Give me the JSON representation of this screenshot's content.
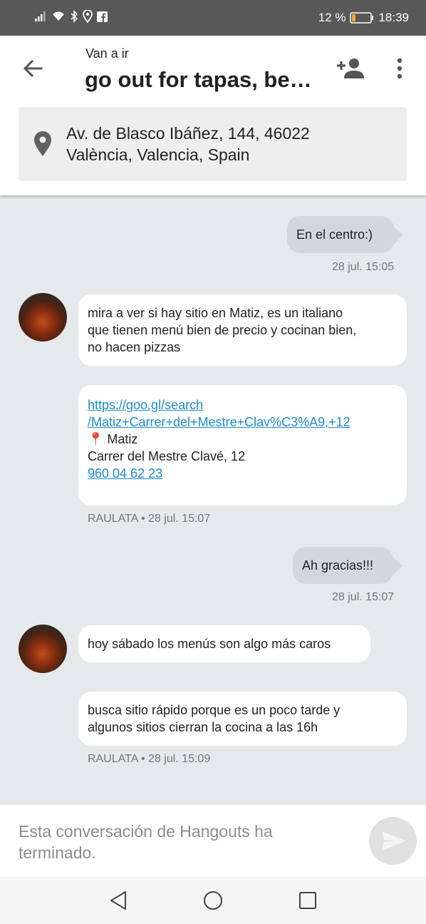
{
  "status_bar": {
    "battery": "12 %",
    "time": "18:39",
    "icons": [
      "signal-icon",
      "wifi-icon",
      "bluetooth-icon",
      "location-icon",
      "facebook-icon",
      "battery-icon"
    ]
  },
  "header": {
    "subtitle": "Van a ir",
    "title": "go out for tapas, be…",
    "location_line1": "Av. de Blasco Ibáñez, 144, 46022",
    "location_line2": "València, Valencia, Spain"
  },
  "messages": [
    {
      "from": "me",
      "text": "En el centro:)",
      "time": "28 jul. 15:05"
    },
    {
      "from": "raulata",
      "text_lines": [
        "mira a ver si hay sitio en Matiz, es un italiano",
        "que tienen menú bien de precio y cocinan bien,",
        "no hacen pizzas"
      ]
    },
    {
      "from": "raulata",
      "link_line1": "https://goo.gl/search",
      "link_line2": "/Matiz+Carrer+del+Mestre+Clav%C3%A9,+12",
      "pin_emoji": "📍",
      "place": " Matiz",
      "street": "Carrer del Mestre Clavé, 12",
      "phone": "960 04 62 23",
      "meta": "RAULATA • 28 jul. 15:07"
    },
    {
      "from": "me",
      "text": "Ah gracias!!!",
      "time": "28 jul. 15:07"
    },
    {
      "from": "raulata",
      "text": "hoy sábado los menús son algo más caros"
    },
    {
      "from": "raulata",
      "text_lines": [
        "busca sitio rápido porque es un poco tarde y",
        "algunos sitios cierran la cocina a las 16h"
      ],
      "meta": "RAULATA • 28 jul. 15:09"
    }
  ],
  "footer": {
    "notice": "Esta conversación de Hangouts ha terminado."
  },
  "colors": {
    "status_bar": "#585858",
    "background": "#e6e9ec",
    "my_bubble": "#d3d7dc",
    "link": "#1a8bd8"
  }
}
